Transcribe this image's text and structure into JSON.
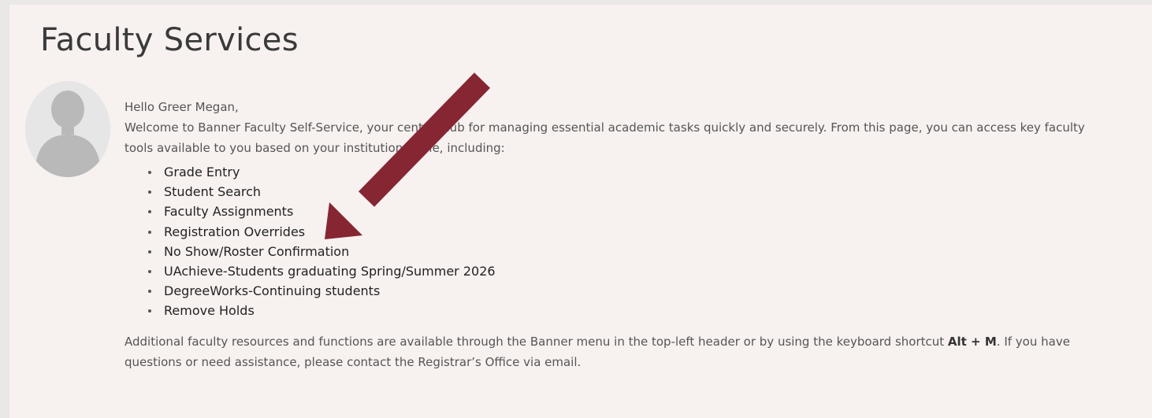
{
  "page": {
    "title": "Faculty Services"
  },
  "greeting": {
    "hello": "Hello Greer Megan,",
    "welcome_line1": "Welcome to Banner Faculty Self-Service, your central hub for managing essential academic tasks quickly and securely. From this page, you can access key faculty",
    "welcome_line2": "tools available to you based on your institutional role, including:"
  },
  "features": [
    "Grade Entry",
    "Student Search",
    "Faculty Assignments",
    "Registration Overrides",
    "No Show/Roster Confirmation",
    "UAchieve-Students graduating Spring/Summer 2026",
    "DegreeWorks-Continuing students",
    "Remove Holds"
  ],
  "footer": {
    "line1_before": "Additional faculty resources and functions are available through the Banner menu in the top-left header or by using the keyboard shortcut ",
    "shortcut": "Alt + M",
    "line1_after": ". If you have",
    "line2": "questions or need assistance, please contact the Registrar’s Office via email."
  },
  "colors": {
    "arrow": "#862633",
    "panel_background": "#f7f1f0",
    "avatar_background": "#e6e6e6",
    "avatar_silhouette": "#b9b9b9"
  },
  "icons": {
    "avatar": "user-silhouette-icon",
    "annotation": "arrow-down-left-icon"
  }
}
